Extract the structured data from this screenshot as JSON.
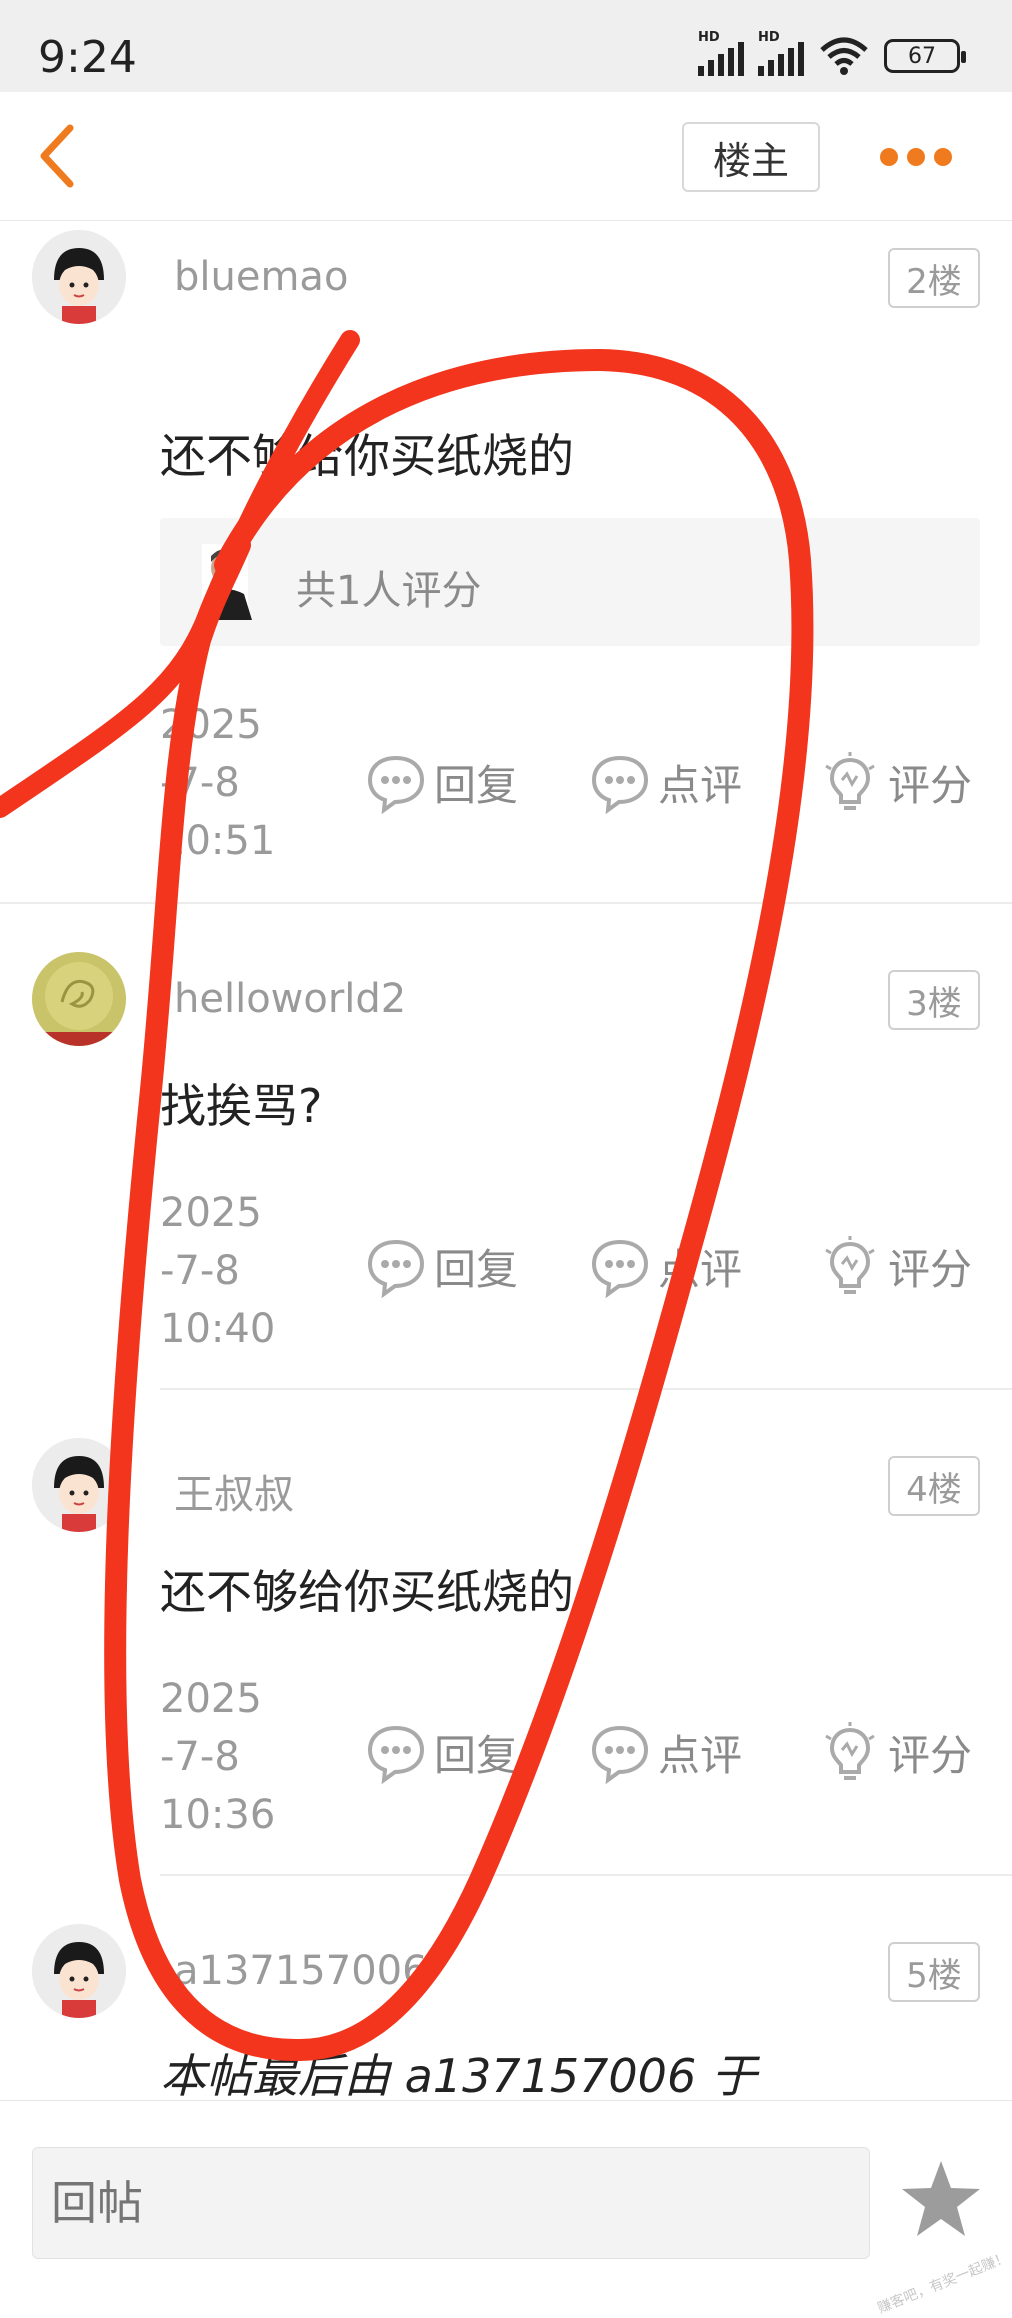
{
  "status_bar": {
    "time": "9:24",
    "battery": "67",
    "network_label": "HD"
  },
  "nav": {
    "op_filter_label": "楼主"
  },
  "posts": [
    {
      "username": "bluemao",
      "floor": "2楼",
      "content": "还不够给你买纸烧的",
      "rating_text": "共1人评分",
      "time_lines": [
        "2025",
        "-7-8",
        "10:51"
      ],
      "actions": {
        "reply": "回复",
        "comment": "点评",
        "rate": "评分"
      }
    },
    {
      "username": "helloworld2",
      "floor": "3楼",
      "content": "找挨骂?",
      "time_lines": [
        "2025",
        "-7-8",
        "10:40"
      ],
      "actions": {
        "reply": "回复",
        "comment": "点评",
        "rate": "评分"
      }
    },
    {
      "username": "王叔叔",
      "floor": "4楼",
      "content": "还不够给你买纸烧的",
      "time_lines": [
        "2025",
        "-7-8",
        "10:36"
      ],
      "actions": {
        "reply": "回复",
        "comment": "点评",
        "rate": "评分"
      }
    },
    {
      "username": "a137157006",
      "floor": "5楼",
      "content": "本帖最后由 a137157006 于"
    }
  ],
  "bottom_bar": {
    "reply_placeholder": "回帖",
    "watermark": "赚客吧，有奖一起赚！ www.zuanke8.com"
  },
  "colors": {
    "accent": "#f07b1e",
    "annotation": "#f2351c"
  }
}
